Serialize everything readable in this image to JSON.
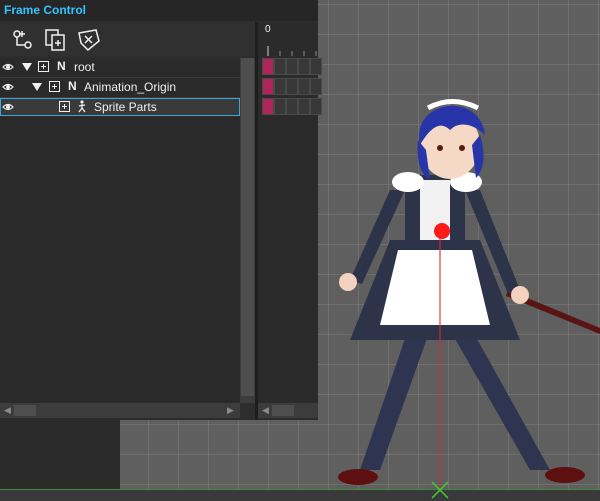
{
  "panel": {
    "title": "Frame Control",
    "toolbar": [
      {
        "icon": "add-part-icon"
      },
      {
        "icon": "duplicate-part-icon"
      },
      {
        "icon": "delete-part-icon"
      }
    ]
  },
  "tree": {
    "rows": [
      {
        "type_label": "N",
        "label": "root",
        "expanded": true,
        "selected": false
      },
      {
        "type_label": "N",
        "label": "Animation_Origin",
        "expanded": true,
        "selected": false
      },
      {
        "type_label": "",
        "label": "Sprite Parts",
        "expanded": false,
        "selected": true,
        "icon": "sprite-part-icon"
      }
    ]
  },
  "timeline": {
    "current_frame_label": "0",
    "keyframe_color": "#b0245a"
  },
  "colors": {
    "title": "#33c4ff",
    "selection_outline": "#3aa6dd",
    "origin": "#ff1a1a"
  }
}
